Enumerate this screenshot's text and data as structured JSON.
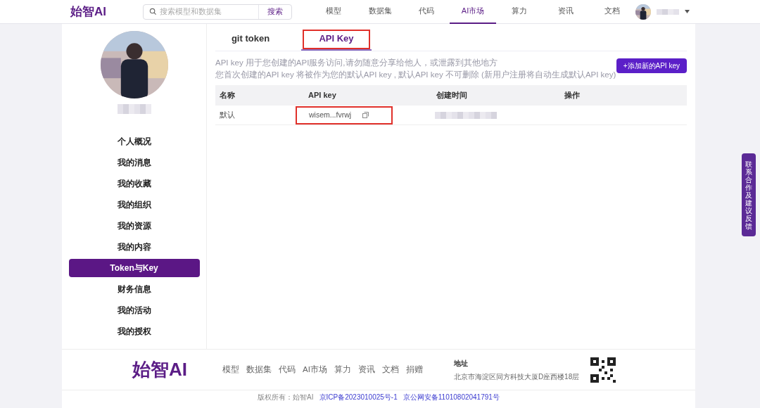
{
  "header": {
    "logo": "始智AI",
    "search": {
      "placeholder": "搜索模型和数据集",
      "button": "搜索"
    },
    "nav": [
      {
        "label": "模型",
        "selected": false
      },
      {
        "label": "数据集",
        "selected": false
      },
      {
        "label": "代码",
        "selected": false
      },
      {
        "label": "AI市场",
        "selected": true
      },
      {
        "label": "算力",
        "selected": false
      },
      {
        "label": "资讯",
        "selected": false
      },
      {
        "label": "文档",
        "selected": false
      }
    ]
  },
  "sidebar": {
    "items": [
      {
        "label": "个人概况",
        "selected": false
      },
      {
        "label": "我的消息",
        "selected": false
      },
      {
        "label": "我的收藏",
        "selected": false
      },
      {
        "label": "我的组织",
        "selected": false
      },
      {
        "label": "我的资源",
        "selected": false
      },
      {
        "label": "我的内容",
        "selected": false
      },
      {
        "label": "Token与Key",
        "selected": true
      },
      {
        "label": "财务信息",
        "selected": false
      },
      {
        "label": "我的活动",
        "selected": false
      },
      {
        "label": "我的授权",
        "selected": false
      }
    ]
  },
  "tabs": [
    {
      "label": "git token",
      "selected": false,
      "highlighted": false
    },
    {
      "label": "API Key",
      "selected": true,
      "highlighted": true
    }
  ],
  "notice": [
    "API key 用于您创建的API服务访问,请勿随意分享给他人，或泄露到其他地方",
    "您首次创建的API key 将被作为您的默认API key , 默认API key 不可删除 (新用户注册将自动生成默认API key)"
  ],
  "add_button": "+添加新的API key",
  "table": {
    "columns": [
      "名称",
      "API key",
      "创建时间",
      "操作"
    ],
    "rows": [
      {
        "name": "默认",
        "key": "wisem...fvrwj",
        "key_highlighted": true
      }
    ]
  },
  "feedback_tab": "联系合作及建议反馈",
  "footer": {
    "logo": "始智AI",
    "links": [
      "模型",
      "数据集",
      "代码",
      "AI市场",
      "算力",
      "资讯",
      "文档",
      "捐赠"
    ],
    "address_label": "地址",
    "address": "北京市海淀区同方科技大厦D座西楼18层",
    "copyright": "版权所有：始智AI",
    "icp": "京ICP备2023010025号-1",
    "police": "京公网安备11010802041791号"
  }
}
